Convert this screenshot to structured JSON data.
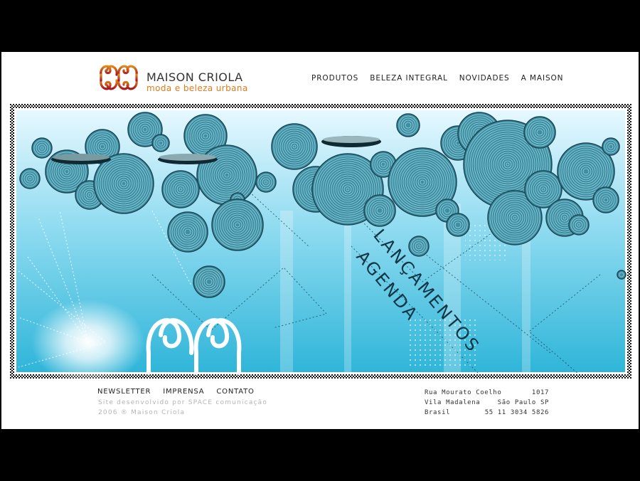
{
  "brand": {
    "name": "MAISON CRIOLA",
    "tagline": "moda e beleza urbana",
    "accent": "#e07b1a",
    "logo_red": "#a8141e",
    "logo_orange": "#e0891a"
  },
  "nav": {
    "items": [
      "PRODUTOS",
      "BELEZA INTEGRAL",
      "NOVIDADES",
      "A MAISON"
    ]
  },
  "banner": {
    "line1": "LANÇAMENTOS",
    "line2": "AGENDA",
    "bg_top": "#e6f8ff",
    "bg_mid": "#8fdbf0",
    "bg_bottom": "#2fb5d9",
    "disc_color": "#3d8fa4"
  },
  "footer": {
    "links": [
      "NEWSLETTER",
      "IMPRENSA",
      "CONTATO"
    ],
    "credit_line1": "Site desenvolvido por SPACE comunicação",
    "credit_line2": "2006 ® Maison Criola",
    "address": {
      "street": "Rua Mourato Coelho",
      "number": "1017",
      "district": "Vila Madalena",
      "city": "São Paulo SP",
      "country": "Brasil",
      "phone": "55 11 3034 5826"
    }
  }
}
